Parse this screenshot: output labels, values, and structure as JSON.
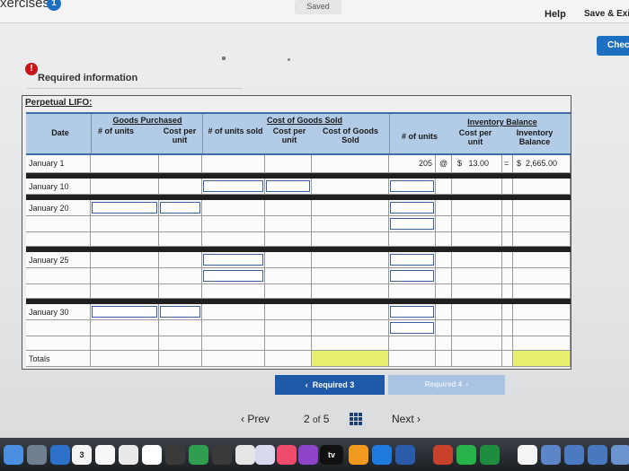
{
  "topbar": {
    "title": "xercises",
    "badge": "1",
    "saved": "Saved",
    "help": "Help",
    "save_exit": "Save & Exi",
    "check": "Chec"
  },
  "alert": {
    "icon": "!",
    "label": "Required information"
  },
  "worksheet": {
    "title": "Perpetual LIFO:",
    "headers": {
      "date": "Date",
      "goods_purchased": "Goods Purchased",
      "gp_units": "# of units",
      "gp_cost": "Cost per unit",
      "cost_of_goods_sold": "Cost of Goods Sold",
      "cogs_units": "# of units sold",
      "cogs_cost": "Cost per unit",
      "cogs_total": "Cost of Goods Sold",
      "inventory_balance": "Inventory Balance",
      "ib_units": "# of units",
      "ib_cost": "Cost per unit",
      "ib_total": "Inventory Balance"
    },
    "rows": {
      "jan1": {
        "date": "January 1",
        "units": "205",
        "at": "@",
        "cost": "$   13.00",
        "eq": "=",
        "balance": "$  2,665.00"
      },
      "jan10": {
        "date": "January 10"
      },
      "jan20": {
        "date": "January 20"
      },
      "jan25": {
        "date": "January 25"
      },
      "jan30": {
        "date": "January 30"
      },
      "totals": {
        "date": "Totals"
      }
    }
  },
  "nav": {
    "req3": "Required 3",
    "req4": "Required 4",
    "prev": "Prev",
    "page": "2",
    "of": "of",
    "total": "5",
    "next": "Next"
  },
  "dock": {
    "calendar_day": "3",
    "tv_label": "tv"
  },
  "colors": {
    "accent_blue": "#1d6fc2",
    "header_blue": "#b2cbe6",
    "highlight_yellow": "#e6ef6e",
    "alert_red": "#c4161c"
  }
}
